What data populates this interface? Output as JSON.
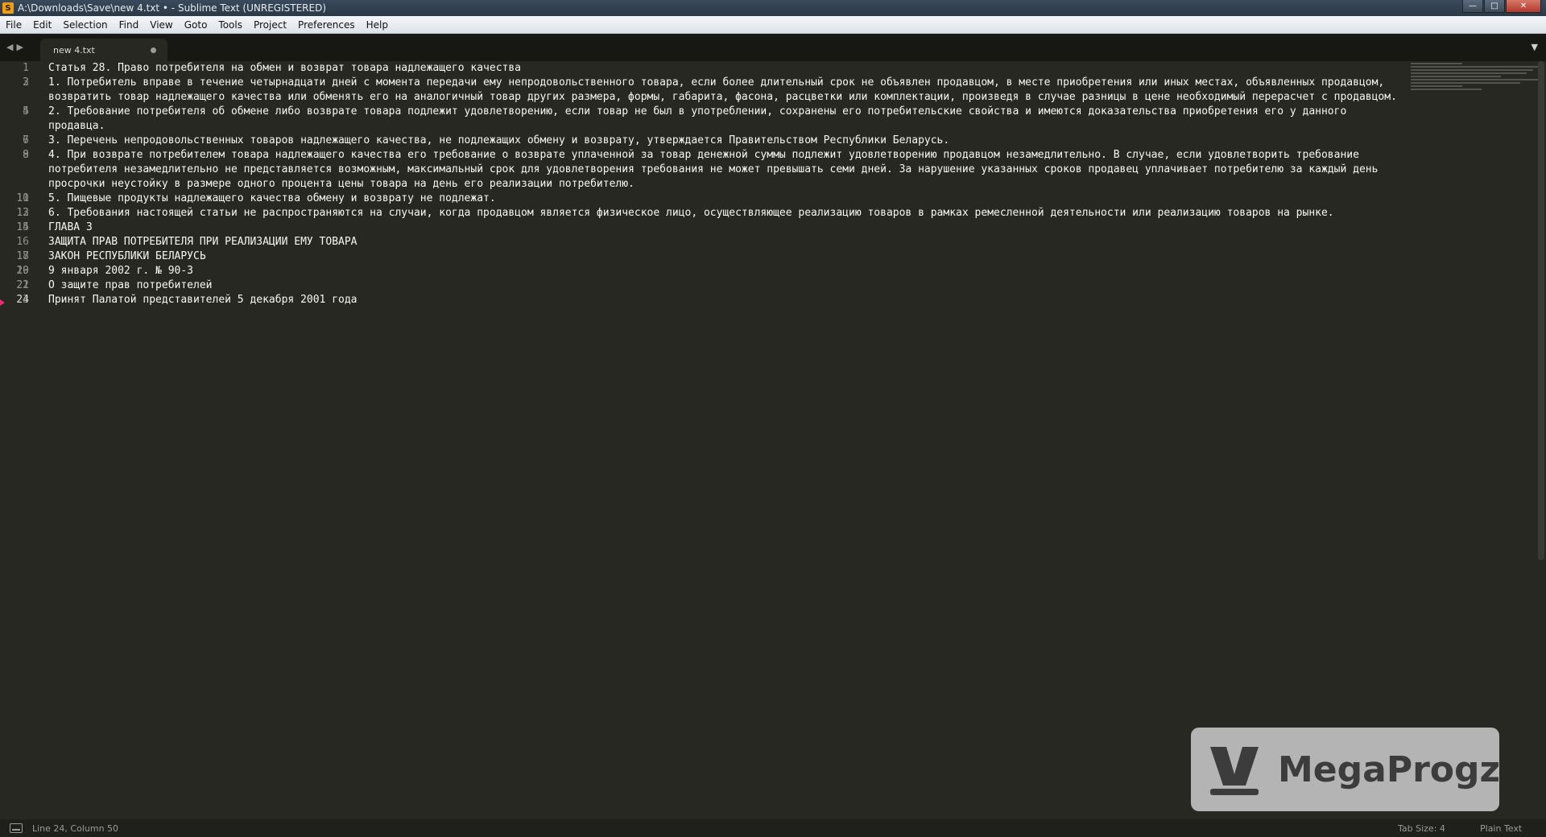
{
  "window": {
    "title": "A:\\Downloads\\Save\\new 4.txt • - Sublime Text (UNREGISTERED)",
    "controls": [
      "minimize",
      "maximize",
      "close"
    ]
  },
  "menu": [
    "File",
    "Edit",
    "Selection",
    "Find",
    "View",
    "Goto",
    "Tools",
    "Project",
    "Preferences",
    "Help"
  ],
  "tabs": [
    {
      "label": "new 4.txt",
      "dirty": true
    }
  ],
  "editor": {
    "lines": [
      {
        "n": "1",
        "text": "Статья 28. Право потребителя на обмен и возврат товара надлежащего качества"
      },
      {
        "n": "2",
        "text": ""
      },
      {
        "n": "3",
        "text": "1. Потребитель вправе в течение четырнадцати дней с момента передачи ему непродовольственного товара, если более длительный срок не объявлен продавцом, в месте приобретения или иных местах, объявленных продавцом, возвратить товар надлежащего качества или обменять его на аналогичный товар других размера, формы, габарита, фасона, расцветки или комплектации, произведя в случае разницы в цене необходимый перерасчет с продавцом."
      },
      {
        "n": "4",
        "text": ""
      },
      {
        "n": "5",
        "text": "2. Требование потребителя об обмене либо возврате товара подлежит удовлетворению, если товар не был в употреблении, сохранены его потребительские свойства и имеются доказательства приобретения его у данного продавца."
      },
      {
        "n": "6",
        "text": ""
      },
      {
        "n": "7",
        "text": "3. Перечень непродовольственных товаров надлежащего качества, не подлежащих обмену и возврату, утверждается Правительством Республики Беларусь."
      },
      {
        "n": "8",
        "text": ""
      },
      {
        "n": "9",
        "text": "4. При возврате потребителем товара надлежащего качества его требование о возврате уплаченной за товар денежной суммы подлежит удовлетворению продавцом незамедлительно. В случае, если удовлетворить требование потребителя незамедлительно не представляется возможным, максимальный срок для удовлетворения требования не может превышать семи дней. За нарушение указанных сроков продавец уплачивает потребителю за каждый день просрочки неустойку в размере одного процента цены товара на день его реализации потребителю."
      },
      {
        "n": "10",
        "text": ""
      },
      {
        "n": "11",
        "text": "5. Пищевые продукты надлежащего качества обмену и возврату не подлежат."
      },
      {
        "n": "12",
        "text": ""
      },
      {
        "n": "13",
        "text": "6. Требования настоящей статьи не распространяются на случаи, когда продавцом является физическое лицо, осуществляющее реализацию товаров в рамках ремесленной деятельности или реализацию товаров на рынке."
      },
      {
        "n": "14",
        "text": ""
      },
      {
        "n": "15",
        "text": "ГЛАВА 3"
      },
      {
        "n": "16",
        "text": "ЗАЩИТА ПРАВ ПОТРЕБИТЕЛЯ ПРИ РЕАЛИЗАЦИИ ЕМУ ТОВАРА"
      },
      {
        "n": "17",
        "text": ""
      },
      {
        "n": "18",
        "text": "ЗАКОН РЕСПУБЛИКИ БЕЛАРУСЬ"
      },
      {
        "n": "19",
        "text": ""
      },
      {
        "n": "20",
        "text": "9 января 2002 г. № 90-З"
      },
      {
        "n": "21",
        "text": ""
      },
      {
        "n": "22",
        "text": "О защите прав потребителей"
      },
      {
        "n": "23",
        "text": ""
      },
      {
        "n": "24",
        "text": "Принят Палатой представителей 5 декабря 2001 года"
      }
    ],
    "current_line": "24"
  },
  "watermark": {
    "text": "MegaProgz"
  },
  "status": {
    "position": "Line 24, Column 50",
    "tab_size": "Tab Size: 4",
    "syntax": "Plain Text"
  },
  "colors": {
    "background": "#272822",
    "text": "#f8f8f2",
    "gutter_text": "#8f908a",
    "marker": "#f92672"
  }
}
